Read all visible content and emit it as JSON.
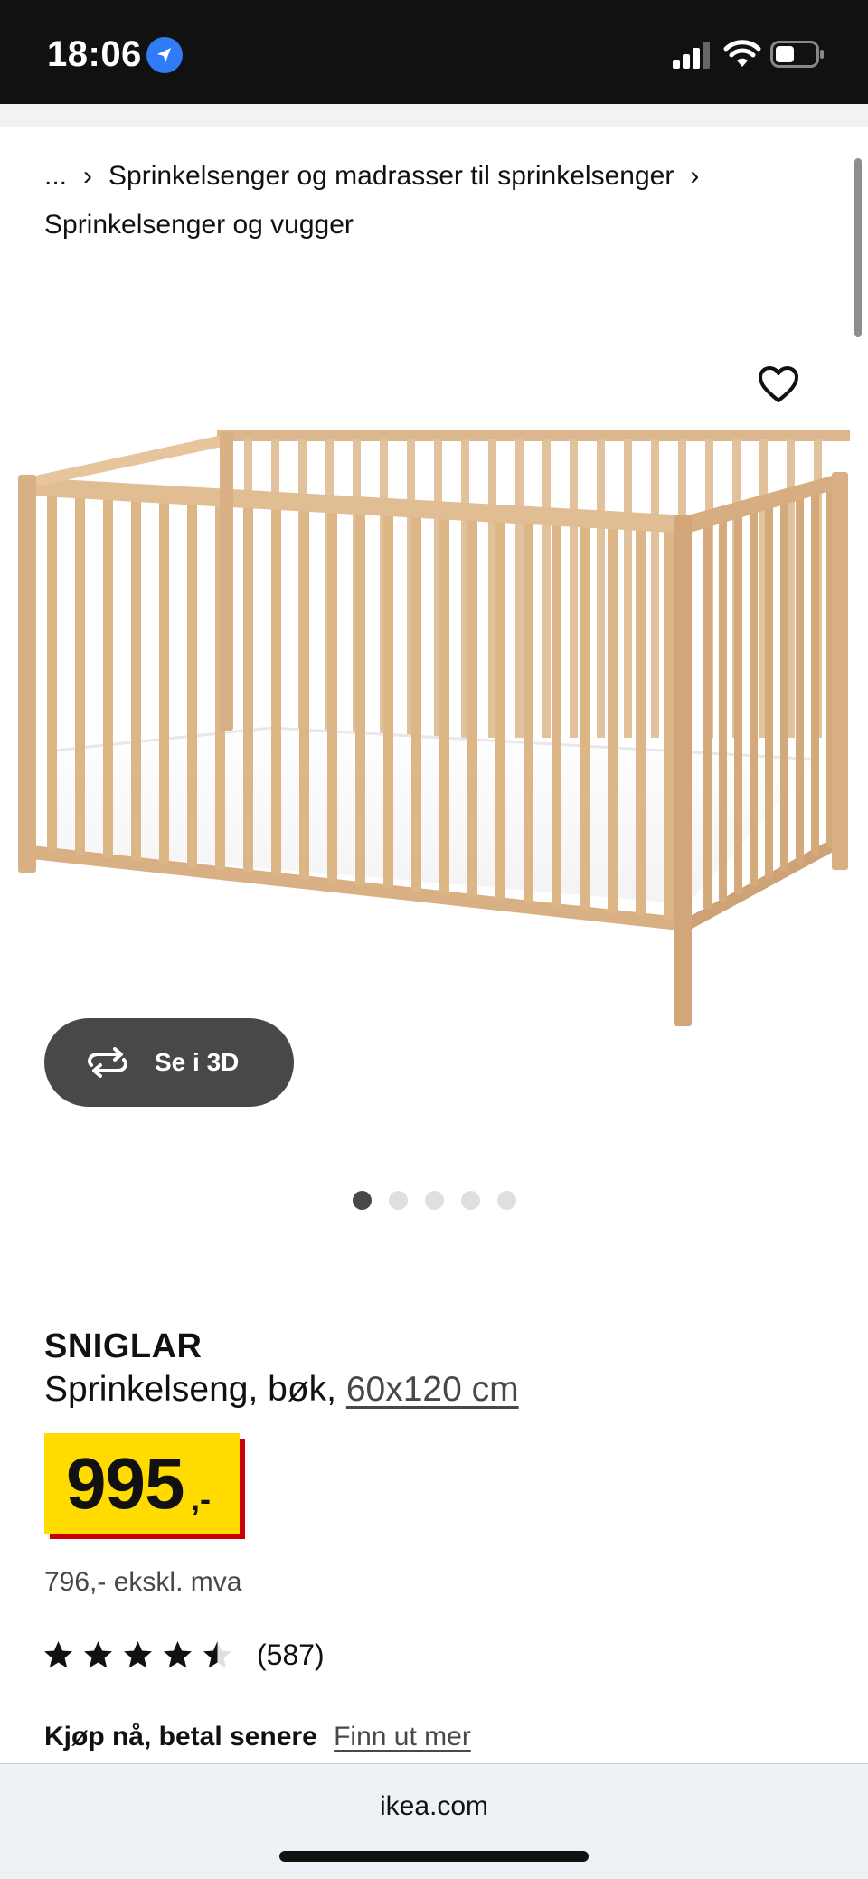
{
  "status_bar": {
    "time": "18:06"
  },
  "breadcrumb": {
    "ellipsis": "...",
    "separator": "›",
    "items": [
      "Sprinkelsenger og madrasser til sprinkelsenger",
      "Sprinkelsenger og vugger"
    ]
  },
  "product": {
    "view_3d_label": "Se i 3D",
    "carousel": {
      "total": 5,
      "active": 1
    },
    "name": "SNIGLAR",
    "description": "Sprinkelseng, bøk,",
    "size": "60x120 cm",
    "price": "995",
    "price_suffix": ",-",
    "price_ex_vat": "796,- ekskl. mva",
    "rating": {
      "value": 4.5,
      "max": 5,
      "count": "(587)"
    },
    "financing_bold": "Kjøp nå, betal senere",
    "financing_link": "Finn ut mer"
  },
  "browser": {
    "url": "ikea.com"
  },
  "colors": {
    "price_tag": "#ffdb00",
    "price_shadow": "#cc0008",
    "button_dark": "#484848",
    "location_blue": "#2f7cf6"
  }
}
